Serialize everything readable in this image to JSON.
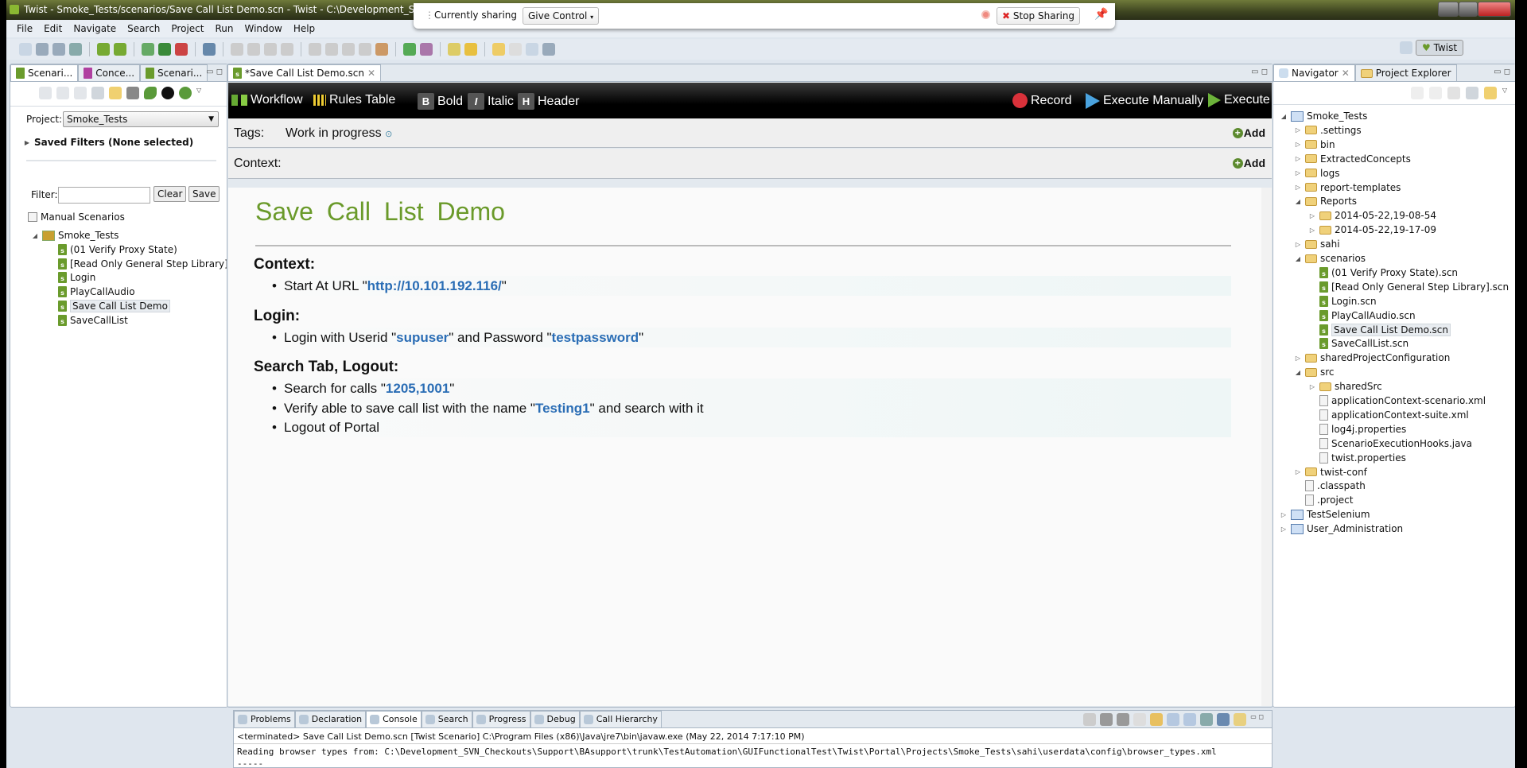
{
  "window": {
    "title": "Twist - Smoke_Tests/scenarios/Save Call List Demo.scn - Twist - C:\\Development_SVN_Check"
  },
  "sharing": {
    "status": "Currently sharing",
    "give_control": "Give Control",
    "stop": "Stop Sharing"
  },
  "menu": [
    "File",
    "Edit",
    "Navigate",
    "Search",
    "Project",
    "Run",
    "Window",
    "Help"
  ],
  "toolbar_icons": [
    "new-icon",
    "save-icon",
    "save-all-icon",
    "print-icon",
    "|",
    "new-scenario-icon",
    "new-concept-icon",
    "|",
    "debug-icon",
    "run-icon",
    "external-tools-icon",
    "|",
    "skip-breakpoints-icon",
    "|",
    "resume-icon",
    "suspend-icon",
    "terminate-icon",
    "disconnect-icon",
    "|",
    "step-into-icon",
    "step-over-icon",
    "step-return-icon",
    "drop-frame-icon",
    "use-step-filters-icon",
    "|",
    "package-icon",
    "refresh-icon",
    "|",
    "open-type-icon",
    "search-icon",
    "|",
    "next-annotation-icon",
    "prev-annotation-icon",
    "back-icon",
    "forward-icon"
  ],
  "perspective": {
    "label": "Twist"
  },
  "left_panel": {
    "tabs": [
      "Scenari...",
      "Conce...",
      "Scenari..."
    ],
    "project_label": "Project:",
    "project_value": "Smoke_Tests",
    "saved_filters": "Saved Filters (None selected)",
    "filter_label": "Filter:",
    "filter_value": "",
    "clear": "Clear",
    "save": "Save",
    "manual_scenarios": "Manual Scenarios",
    "tree": [
      {
        "label": "Smoke_Tests",
        "depth": 0,
        "icon": "project-icon",
        "exp": "open"
      },
      {
        "label": "(01 Verify Proxy State)",
        "depth": 1,
        "icon": "scenario-icon"
      },
      {
        "label": "[Read Only General Step Library]",
        "depth": 1,
        "icon": "scenario-icon"
      },
      {
        "label": "Login",
        "depth": 1,
        "icon": "scenario-icon"
      },
      {
        "label": "PlayCallAudio",
        "depth": 1,
        "icon": "scenario-icon"
      },
      {
        "label": "Save Call List Demo",
        "depth": 1,
        "icon": "scenario-icon",
        "selected": true
      },
      {
        "label": "SaveCallList",
        "depth": 1,
        "icon": "scenario-icon"
      }
    ]
  },
  "editor": {
    "tab": "*Save Call List Demo.scn",
    "toolbar": {
      "workflow": "Workflow",
      "rules_table": "Rules Table",
      "bold_key": "B",
      "bold": "Bold",
      "italic_key": "I",
      "italic": "Italic",
      "header_key": "H",
      "header": "Header",
      "record": "Record",
      "execute_manually": "Execute Manually",
      "execute": "Execute"
    },
    "tags_label": "Tags:",
    "tags_value": "Work in progress",
    "add": "Add",
    "context_label": "Context:",
    "doc": {
      "title": "Save Call List Demo",
      "sections": [
        {
          "heading": "Context:",
          "steps": [
            [
              {
                "t": "Start At URL \""
              },
              {
                "b": "http://10.101.192.116/"
              },
              {
                "t": "\""
              }
            ]
          ]
        },
        {
          "heading": "Login:",
          "steps": [
            [
              {
                "t": "Login with Userid \""
              },
              {
                "b": "supuser"
              },
              {
                "t": "\" and Password \""
              },
              {
                "b": "testpassword"
              },
              {
                "t": "\""
              }
            ]
          ]
        },
        {
          "heading": "Search Tab, Logout:",
          "steps": [
            [
              {
                "t": "Search for calls \""
              },
              {
                "b": "1205,1001"
              },
              {
                "t": "\""
              }
            ],
            [
              {
                "t": "Verify able to save call list with the name \""
              },
              {
                "b": "Testing1"
              },
              {
                "t": "\" and search with it"
              }
            ],
            [
              {
                "t": "Logout of Portal"
              }
            ]
          ]
        }
      ]
    }
  },
  "right_panel": {
    "tabs": [
      "Navigator",
      "Project Explorer"
    ],
    "tree": [
      {
        "label": "Smoke_Tests",
        "depth": 0,
        "icon": "project-icon",
        "exp": "open"
      },
      {
        "label": ".settings",
        "depth": 1,
        "icon": "folder-icon",
        "exp": "closed"
      },
      {
        "label": "bin",
        "depth": 1,
        "icon": "folder-icon",
        "exp": "closed"
      },
      {
        "label": "ExtractedConcepts",
        "depth": 1,
        "icon": "folder-icon",
        "exp": "closed"
      },
      {
        "label": "logs",
        "depth": 1,
        "icon": "folder-icon",
        "exp": "closed"
      },
      {
        "label": "report-templates",
        "depth": 1,
        "icon": "folder-icon",
        "exp": "closed"
      },
      {
        "label": "Reports",
        "depth": 1,
        "icon": "folder-icon",
        "exp": "open"
      },
      {
        "label": "2014-05-22,19-08-54",
        "depth": 2,
        "icon": "folder-icon",
        "exp": "closed"
      },
      {
        "label": "2014-05-22,19-17-09",
        "depth": 2,
        "icon": "folder-icon",
        "exp": "closed"
      },
      {
        "label": "sahi",
        "depth": 1,
        "icon": "folder-icon",
        "exp": "closed"
      },
      {
        "label": "scenarios",
        "depth": 1,
        "icon": "folder-icon",
        "exp": "open"
      },
      {
        "label": "(01 Verify Proxy State).scn",
        "depth": 2,
        "icon": "scenario-icon"
      },
      {
        "label": "[Read Only General Step Library].scn",
        "depth": 2,
        "icon": "scenario-icon"
      },
      {
        "label": "Login.scn",
        "depth": 2,
        "icon": "scenario-icon"
      },
      {
        "label": "PlayCallAudio.scn",
        "depth": 2,
        "icon": "scenario-icon"
      },
      {
        "label": "Save Call List Demo.scn",
        "depth": 2,
        "icon": "scenario-icon",
        "selected": true
      },
      {
        "label": "SaveCallList.scn",
        "depth": 2,
        "icon": "scenario-icon"
      },
      {
        "label": "sharedProjectConfiguration",
        "depth": 1,
        "icon": "folder-icon",
        "exp": "closed"
      },
      {
        "label": "src",
        "depth": 1,
        "icon": "folder-icon",
        "exp": "open"
      },
      {
        "label": "sharedSrc",
        "depth": 2,
        "icon": "folder-icon",
        "exp": "closed"
      },
      {
        "label": "applicationContext-scenario.xml",
        "depth": 2,
        "icon": "file-icon"
      },
      {
        "label": "applicationContext-suite.xml",
        "depth": 2,
        "icon": "file-icon"
      },
      {
        "label": "log4j.properties",
        "depth": 2,
        "icon": "file-icon"
      },
      {
        "label": "ScenarioExecutionHooks.java",
        "depth": 2,
        "icon": "java-file-icon"
      },
      {
        "label": "twist.properties",
        "depth": 2,
        "icon": "file-icon"
      },
      {
        "label": "twist-conf",
        "depth": 1,
        "icon": "folder-icon",
        "exp": "closed"
      },
      {
        "label": ".classpath",
        "depth": 1,
        "icon": "file-icon"
      },
      {
        "label": ".project",
        "depth": 1,
        "icon": "file-icon"
      },
      {
        "label": "TestSelenium",
        "depth": 0,
        "icon": "project-icon",
        "exp": "closed"
      },
      {
        "label": "User_Administration",
        "depth": 0,
        "icon": "project-icon",
        "exp": "closed"
      }
    ]
  },
  "bottom": {
    "tabs": [
      "Problems",
      "Declaration",
      "Console",
      "Search",
      "Progress",
      "Debug",
      "Call Hierarchy"
    ],
    "active_tab": "Console",
    "status": "<terminated> Save Call List Demo.scn [Twist Scenario] C:\\Program Files (x86)\\Java\\jre7\\bin\\javaw.exe (May 22, 2014 7:17:10 PM)",
    "lines": [
      "Reading browser types from: C:\\Development_SVN_Checkouts\\Support\\BAsupport\\trunk\\TestAutomation\\GUIFunctionalTest\\Twist\\Portal\\Projects\\Smoke_Tests\\sahi\\userdata\\config\\browser_types.xml",
      "-----"
    ]
  },
  "colors": {
    "accent_green": "#6a9a2a",
    "link_blue": "#2a6db5",
    "record_red": "#d9313a"
  }
}
